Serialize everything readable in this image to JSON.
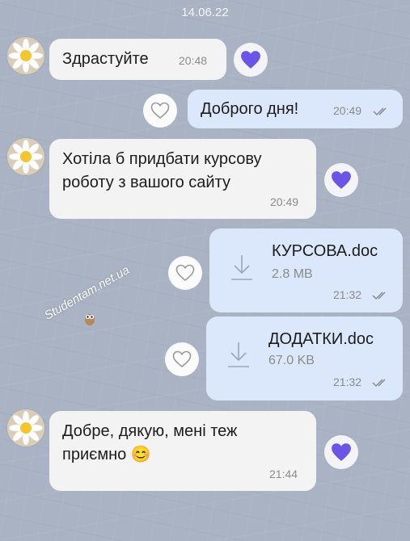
{
  "date": "14.06.22",
  "watermark": "Studentam.net.ua",
  "colors": {
    "accent": "#6a55e6",
    "incoming": "#f3f3f3",
    "outgoing": "#dbe8fb"
  },
  "messages": [
    {
      "direction": "in",
      "text": "Здрастуйте",
      "time": "20:48",
      "reaction": "heart-filled"
    },
    {
      "direction": "out",
      "text": "Доброго дня!",
      "time": "20:49",
      "status": "read",
      "reaction": "heart-outline"
    },
    {
      "direction": "in",
      "text": "Хотіла б придбати курсову\nроботу з вашого сайту",
      "time": "20:49",
      "reaction": "heart-filled"
    },
    {
      "direction": "out",
      "file": {
        "name": "КУРСОВА.doc",
        "size": "2.8 MB"
      },
      "time": "21:32",
      "status": "read",
      "reaction": "heart-outline"
    },
    {
      "direction": "out",
      "file": {
        "name": "ДОДАТКИ.doc",
        "size": "67.0 KB"
      },
      "time": "21:32",
      "status": "read",
      "reaction": "heart-outline"
    },
    {
      "direction": "in",
      "text": "Добре, дякую, мені теж\nприємно 😊",
      "time": "21:44",
      "reaction": "heart-filled"
    }
  ]
}
